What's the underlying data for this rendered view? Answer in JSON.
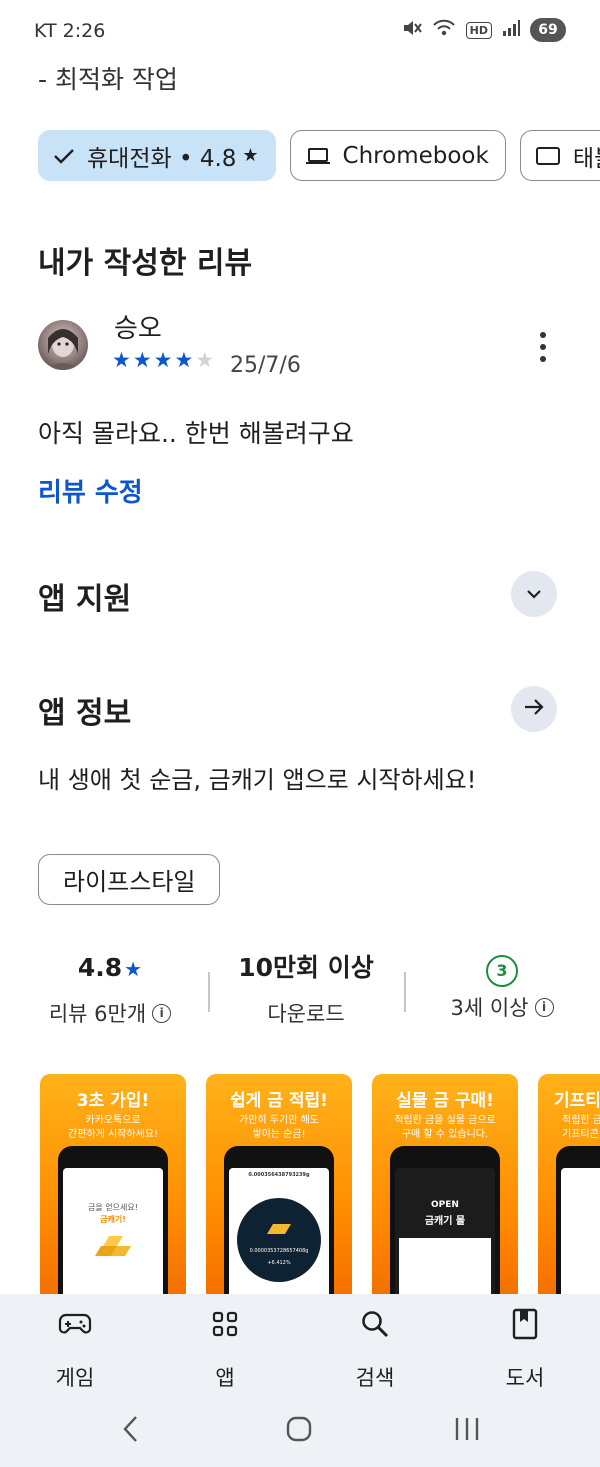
{
  "status_bar": {
    "carrier_time": "KT 2:26",
    "battery": "69",
    "hd": "HD",
    "icons": [
      "mute-icon",
      "wifi-icon",
      "hd-icon",
      "signal-icon",
      "battery-icon"
    ]
  },
  "top_fragment": "- 최적화 작업",
  "device_chips": [
    {
      "label": "휴대전화 • 4.8",
      "selected": true,
      "icon": "check-icon"
    },
    {
      "label": "Chromebook",
      "selected": false,
      "icon": "laptop-icon"
    },
    {
      "label": "태블릿",
      "selected": false,
      "icon": "tablet-icon"
    }
  ],
  "my_review": {
    "heading": "내가 작성한 리뷰",
    "reviewer": "승오",
    "rating": 4,
    "max_rating": 5,
    "date": "25/7/6",
    "text": "아직 몰라요.. 한번 해볼려구요",
    "edit_label": "리뷰 수정"
  },
  "app_support": {
    "heading": "앱 지원"
  },
  "app_info": {
    "heading": "앱 정보",
    "description": "내 생애 첫 순금, 금캐기 앱으로 시작하세요!",
    "category": "라이프스타일"
  },
  "stats": {
    "rating_value": "4.8",
    "rating_label": "리뷰 6만개",
    "downloads_value": "10만회 이상",
    "downloads_label": "다운로드",
    "age_value": "3",
    "age_label": "3세 이상"
  },
  "screenshots": [
    {
      "title": "3초 가입!",
      "subtitle": "카카오톡으로\n간편하게 시작하세요!",
      "screen_line1": "금을 얻으세요!",
      "screen_line2": "금캐기!"
    },
    {
      "title": "쉽게 금 적립!",
      "subtitle": "가만히 두기만 해도\n쌓이는 순금!",
      "screen_top": "0.000356438793239g",
      "screen_mid": "0.0000353728657408g",
      "screen_pct": "+6.412%"
    },
    {
      "title": "실물 금 구매!",
      "subtitle": "적립한 금을 실물 금으로\n구매 할 수 있습니다.",
      "screen_open": "OPEN",
      "screen_mall": "금캐기 몰"
    },
    {
      "title": "기프티",
      "subtitle": "적립한 금\n기프티콘"
    }
  ],
  "bottom_nav": [
    {
      "label": "게임",
      "icon": "gamepad-icon"
    },
    {
      "label": "앱",
      "icon": "apps-grid-icon"
    },
    {
      "label": "검색",
      "icon": "search-icon"
    },
    {
      "label": "도서",
      "icon": "book-icon"
    }
  ],
  "colors": {
    "accent": "#0b57d0",
    "chip_selected": "#c8e3f8",
    "star": "#0b57d0",
    "age_green": "#1e8e3e",
    "nav_bg": "#eef1f6"
  }
}
